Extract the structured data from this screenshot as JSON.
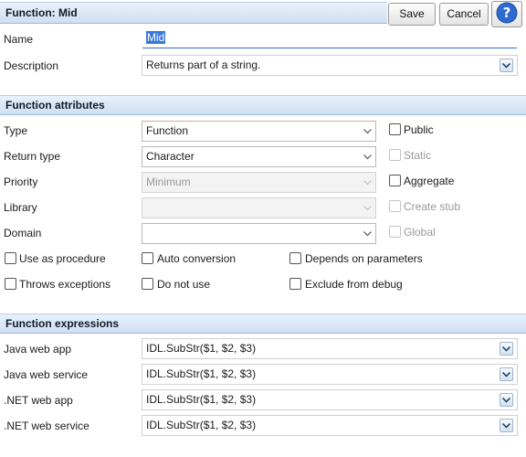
{
  "header": {
    "title": "Function: Mid",
    "save_label": "Save",
    "cancel_label": "Cancel"
  },
  "general": {
    "name_label": "Name",
    "name_value": "Mid",
    "description_label": "Description",
    "description_value": "Returns part of a string."
  },
  "attributes": {
    "section_title": "Function attributes",
    "type_label": "Type",
    "type_value": "Function",
    "return_type_label": "Return type",
    "return_type_value": "Character",
    "priority_label": "Priority",
    "priority_value": "Minimum",
    "library_label": "Library",
    "library_value": "",
    "domain_label": "Domain",
    "domain_value": "",
    "checks_right": [
      {
        "label": "Public",
        "checked": false,
        "enabled": true
      },
      {
        "label": "Static",
        "checked": false,
        "enabled": false
      },
      {
        "label": "Aggregate",
        "checked": false,
        "enabled": true
      },
      {
        "label": "Create stub",
        "checked": false,
        "enabled": false
      },
      {
        "label": "Global",
        "checked": false,
        "enabled": false
      }
    ],
    "checks_bottom": [
      {
        "label": "Use as procedure",
        "checked": false
      },
      {
        "label": "Auto conversion",
        "checked": false
      },
      {
        "label": "Depends on parameters",
        "checked": false
      },
      {
        "label": "Throws exceptions",
        "checked": false
      },
      {
        "label": "Do not use",
        "checked": false
      },
      {
        "label": "Exclude from debug",
        "checked": false
      }
    ]
  },
  "expressions": {
    "section_title": "Function expressions",
    "rows": [
      {
        "label": "Java web app",
        "value": "IDL.SubStr($1, $2, $3)"
      },
      {
        "label": "Java web service",
        "value": "IDL.SubStr($1, $2, $3)"
      },
      {
        "label": ".NET web app",
        "value": "IDL.SubStr($1, $2, $3)"
      },
      {
        "label": ".NET web service",
        "value": "IDL.SubStr($1, $2, $3)"
      }
    ]
  },
  "icons": {
    "help": "help-icon",
    "dropdown": "chevron-down-icon"
  },
  "colors": {
    "section_header": "#cfdff2",
    "selection": "#3a78d8",
    "help_blue": "#2f6ad0"
  }
}
